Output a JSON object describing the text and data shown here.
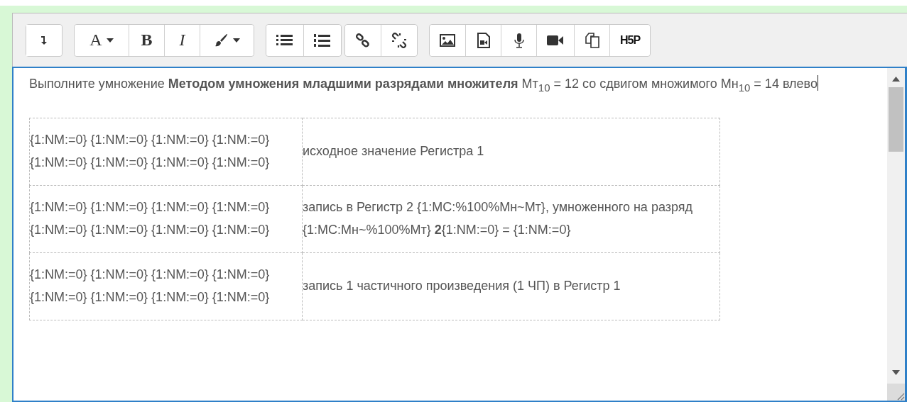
{
  "toolbar": {
    "groups": [
      {
        "buttons": [
          {
            "kind": "collapse"
          }
        ]
      },
      {
        "buttons": [
          {
            "kind": "font",
            "label": "A"
          },
          {
            "kind": "bold",
            "label": "B"
          },
          {
            "kind": "italic",
            "label": "I"
          },
          {
            "kind": "brush"
          }
        ]
      },
      {
        "buttons": [
          {
            "kind": "bullets"
          },
          {
            "kind": "numbers"
          }
        ]
      },
      {
        "buttons": [
          {
            "kind": "link"
          },
          {
            "kind": "unlink"
          }
        ]
      },
      {
        "buttons": [
          {
            "kind": "image"
          },
          {
            "kind": "media"
          },
          {
            "kind": "microphone"
          },
          {
            "kind": "video"
          },
          {
            "kind": "copy"
          },
          {
            "kind": "h5p",
            "label": "H5P"
          }
        ]
      }
    ]
  },
  "editor": {
    "intro": "Выполните умножение **Методом умножения младшими разрядами множителя** Мт$_{10}$ = 12 со сдвигом множимого Мн$_{10}$ = 14 влево",
    "table": {
      "rows": [
        {
          "cells": [
            "{1:NM:=0} {1:NM:=0} {1:NM:=0} {1:NM:=0} {1:NM:=0} {1:NM:=0} {1:NM:=0} {1:NM:=0}",
            "исходное значение Регистра 1"
          ]
        },
        {
          "cells": [
            "{1:NM:=0} {1:NM:=0} {1:NM:=0} {1:NM:=0} {1:NM:=0} {1:NM:=0} {1:NM:=0} {1:NM:=0}",
            "запись в Регистр 2 {1:MC:%100%Мн~Мт}, умноженного на разряд {1:MC:Мн~%100%Мт} **2**{1:NM:=0} = {1:NM:=0}"
          ]
        },
        {
          "cells": [
            "{1:NM:=0} {1:NM:=0} {1:NM:=0} {1:NM:=0} {1:NM:=0} {1:NM:=0} {1:NM:=0} {1:NM:=0}",
            "запись 1 частичного произведения (1 ЧП) в Регистр 1"
          ]
        }
      ]
    }
  }
}
